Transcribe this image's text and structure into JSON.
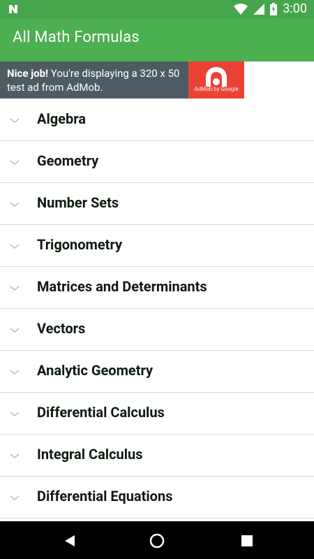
{
  "status_bar": {
    "time": "3:00",
    "icons": [
      "wifi-icon",
      "signal-icon",
      "battery-icon"
    ],
    "left_icon": "n-logo-icon"
  },
  "app_bar": {
    "title": "All Math Formulas",
    "color": "#4CAF50"
  },
  "ad": {
    "title": "Nice job!",
    "message": " You're displaying a 320 x 50 test ad from AdMob.",
    "brand": "AdMob by Google",
    "colors": {
      "background": "#4F5B63",
      "tile": "#EA4335"
    }
  },
  "topics": [
    {
      "label": "Algebra"
    },
    {
      "label": "Geometry"
    },
    {
      "label": "Number Sets"
    },
    {
      "label": "Trigonometry"
    },
    {
      "label": "Matrices and Determinants"
    },
    {
      "label": "Vectors"
    },
    {
      "label": "Analytic Geometry"
    },
    {
      "label": "Differential Calculus"
    },
    {
      "label": "Integral Calculus"
    },
    {
      "label": "Differential Equations"
    }
  ],
  "nav_bar": {
    "buttons": [
      "back-icon",
      "home-icon",
      "recents-icon"
    ]
  }
}
